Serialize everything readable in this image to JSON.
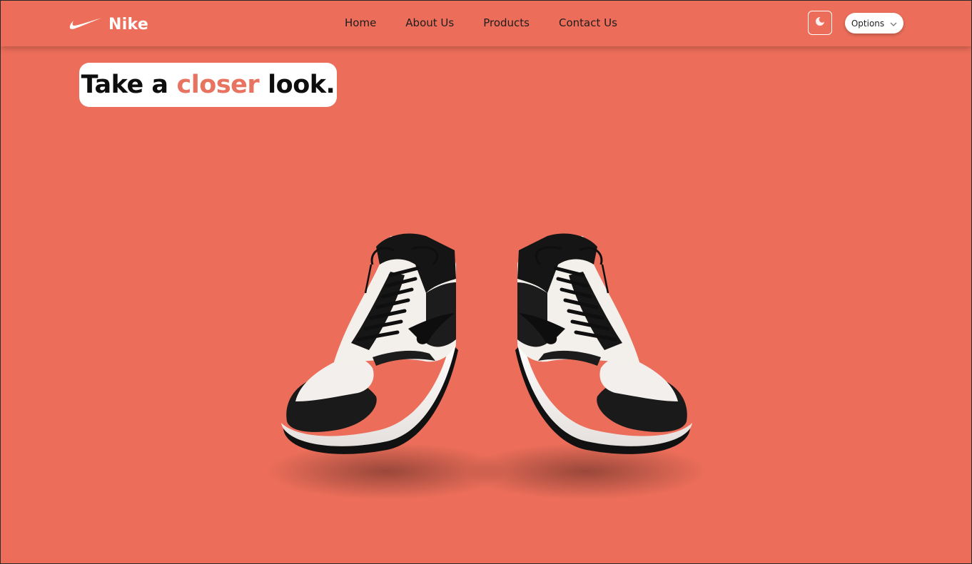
{
  "nav": {
    "brand": "Nike",
    "links": [
      "Home",
      "About Us",
      "Products",
      "Contact Us"
    ],
    "options_label": "Options"
  },
  "hero": {
    "headline_part1": "Take a",
    "headline_accent": "closer",
    "headline_part2": "look."
  },
  "colors": {
    "background": "#ec6e5a",
    "accent_text": "#e97361",
    "text": "#1d1d1d"
  },
  "icons": {
    "logo": "nike-swoosh-icon",
    "theme": "moon-icon",
    "dropdown": "chevron-down-icon"
  }
}
